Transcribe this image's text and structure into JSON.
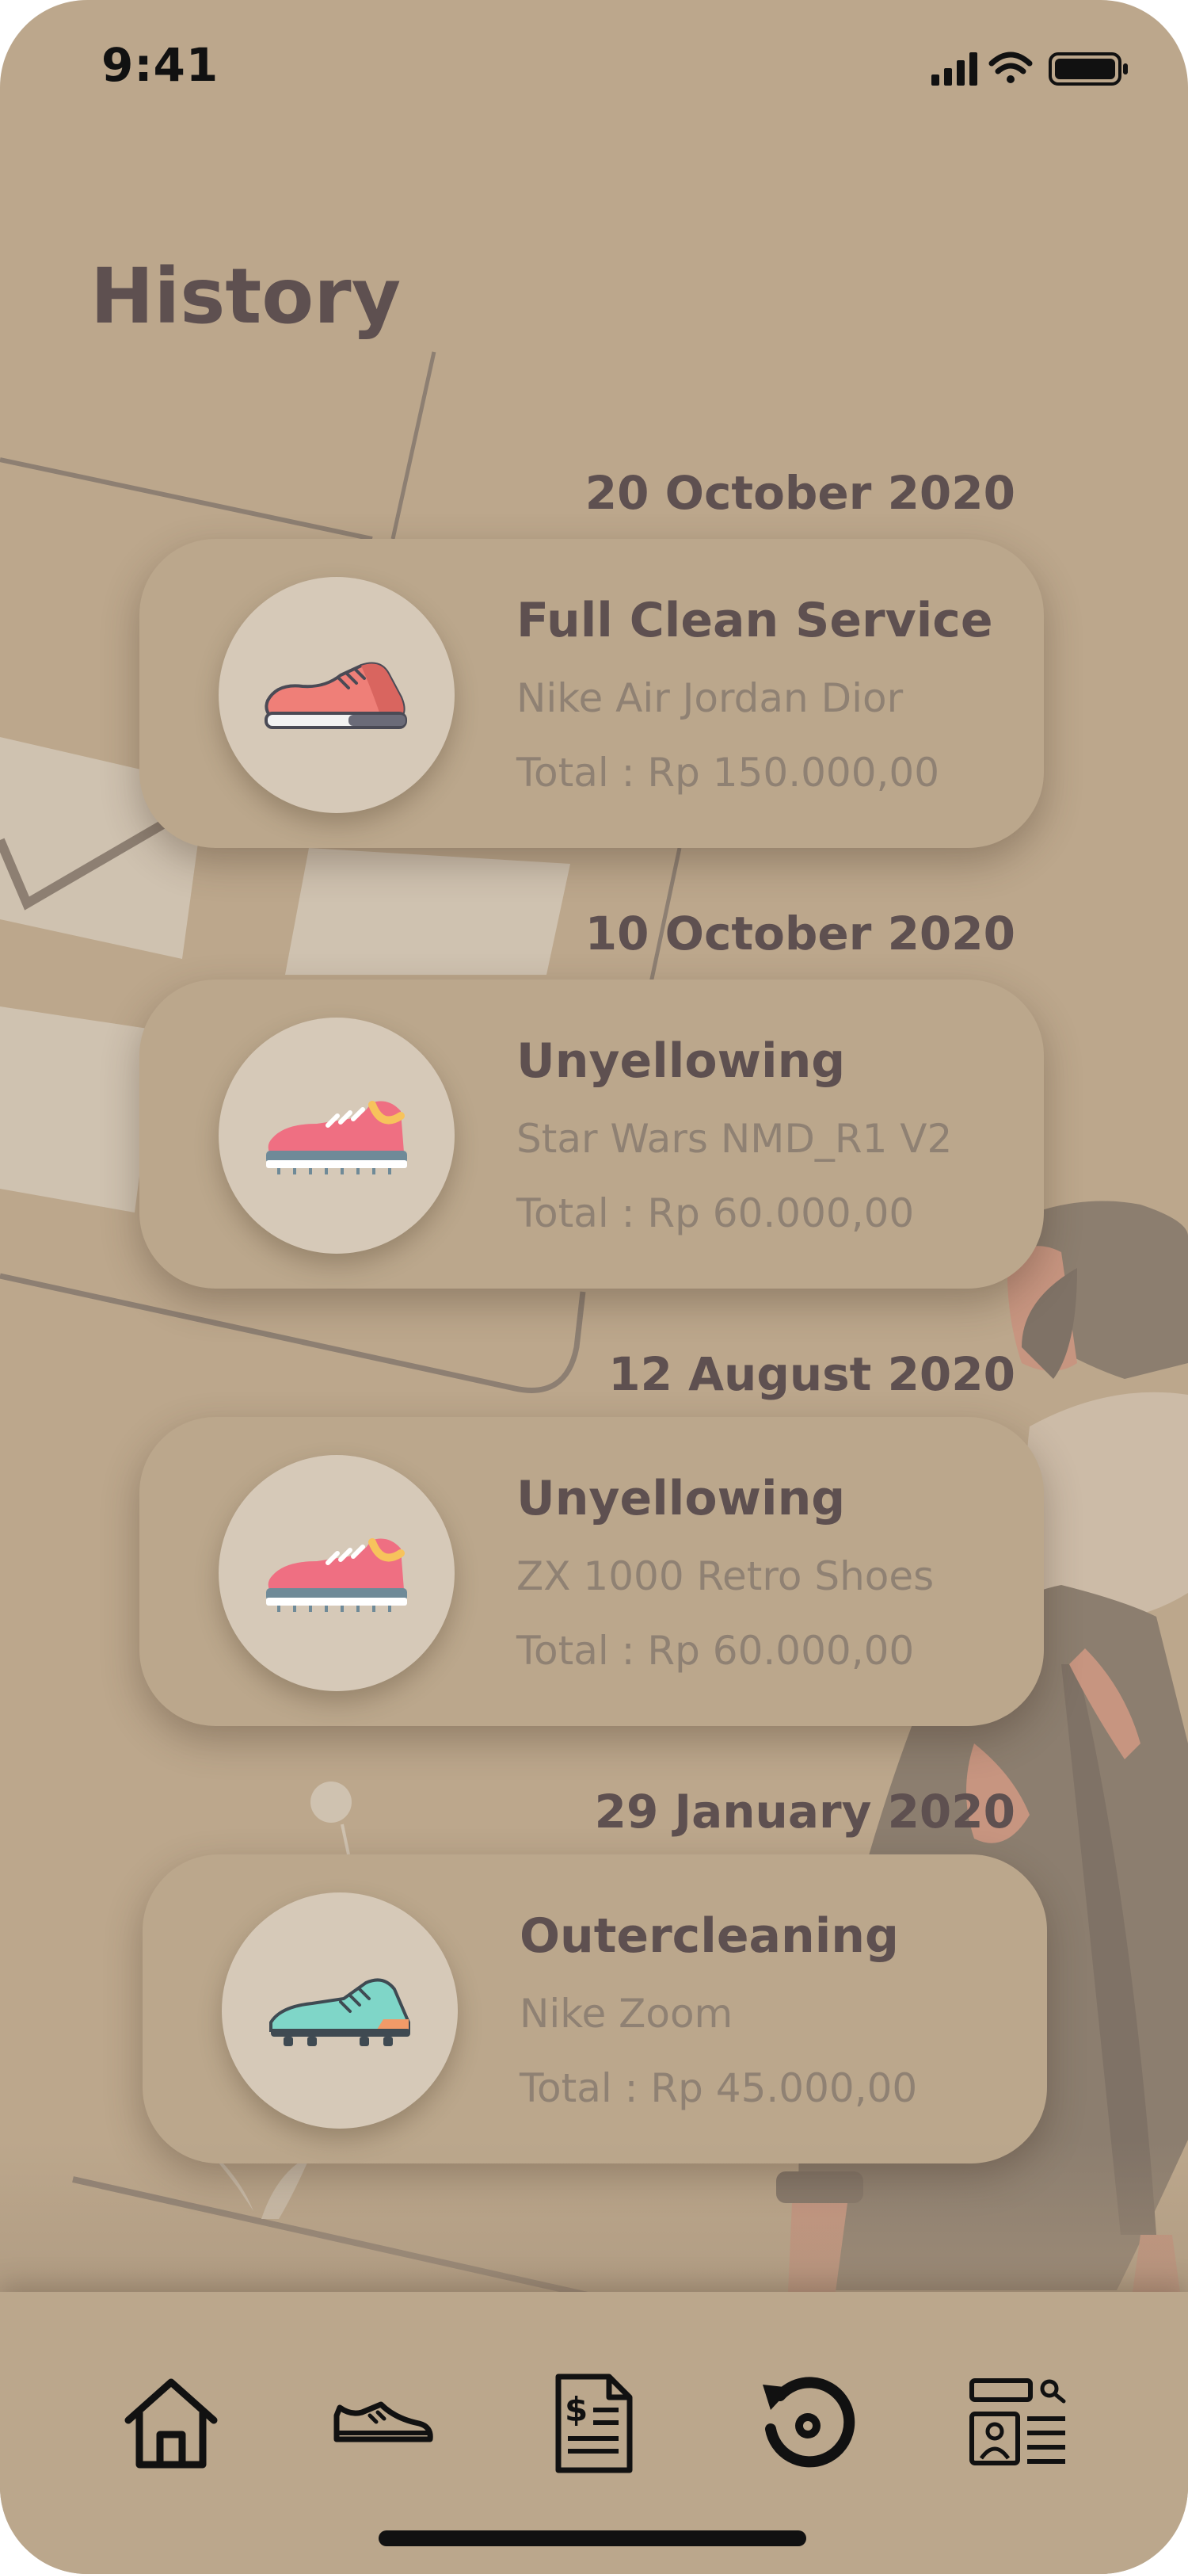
{
  "status_bar": {
    "time": "9:41"
  },
  "page": {
    "title": "History"
  },
  "history": [
    {
      "date": "20 October 2020",
      "service": "Full  Clean Service",
      "shoe": "Nike Air Jordan Dior",
      "total": "Total : Rp 150.000,00",
      "icon": "sneaker-red-icon"
    },
    {
      "date": "10 October 2020",
      "service": "Unyellowing",
      "shoe": "Star Wars NMD_R1 V2",
      "total": "Total : Rp 60.000,00",
      "icon": "sneaker-pink-icon"
    },
    {
      "date": "12 August 2020",
      "service": "Unyellowing",
      "shoe": "ZX 1000 Retro Shoes",
      "total": "Total : Rp 60.000,00",
      "icon": "sneaker-pink-icon"
    },
    {
      "date": "29 January 2020",
      "service": "Outercleaning",
      "shoe": "Nike Zoom",
      "total": "Total : Rp 45.000,00",
      "icon": "sneaker-teal-icon"
    }
  ],
  "nav": [
    {
      "name": "home",
      "icon": "home-icon"
    },
    {
      "name": "shoes",
      "icon": "shoe-icon"
    },
    {
      "name": "invoice",
      "icon": "invoice-icon"
    },
    {
      "name": "history",
      "icon": "history-icon",
      "active": true
    },
    {
      "name": "profile",
      "icon": "profile-card-icon"
    }
  ],
  "colors": {
    "background": "#bca78c",
    "title_text": "#5e5050",
    "secondary_text": "#8f8173",
    "avatar_bg": "#d6c9b8"
  }
}
